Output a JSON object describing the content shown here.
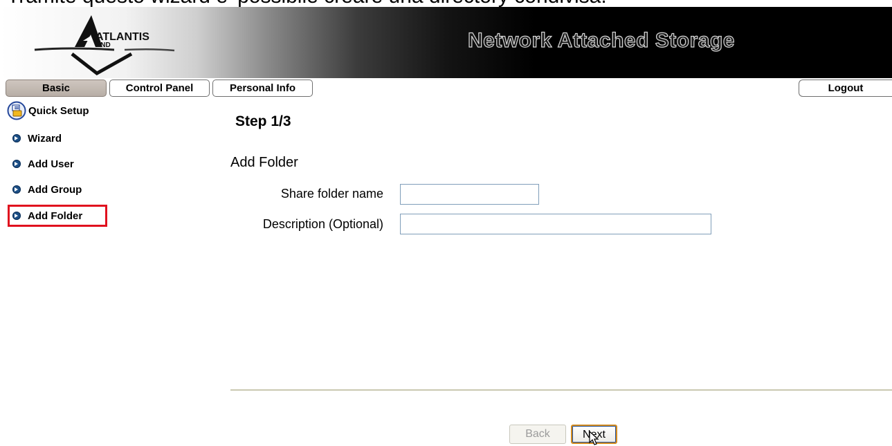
{
  "caption": "Tramite questo wizard e' possibile creare una directory condivisa.",
  "header": {
    "logo_text": "ATLANTIS",
    "logo_subtext": "AND",
    "title": "Network Attached Storage"
  },
  "tabs": [
    {
      "label": "Basic",
      "active": true
    },
    {
      "label": "Control Panel",
      "active": false
    },
    {
      "label": "Personal Info",
      "active": false
    }
  ],
  "logout_label": "Logout",
  "sidebar": {
    "header": "Quick Setup",
    "items": [
      {
        "label": "Wizard"
      },
      {
        "label": "Add User"
      },
      {
        "label": "Add Group"
      },
      {
        "label": "Add Folder",
        "selected": true
      }
    ]
  },
  "main": {
    "step": "Step 1/3",
    "section_title": "Add Folder",
    "fields": [
      {
        "label": "Share folder name",
        "value": ""
      },
      {
        "label": "Description (Optional)",
        "value": ""
      }
    ],
    "back_label": "Back",
    "next_label": "Next"
  },
  "colors": {
    "highlight": "#e0101e",
    "bullet": "#1c4f86",
    "active_tab": "#c4bab2",
    "next_border": "#d38b1f"
  }
}
